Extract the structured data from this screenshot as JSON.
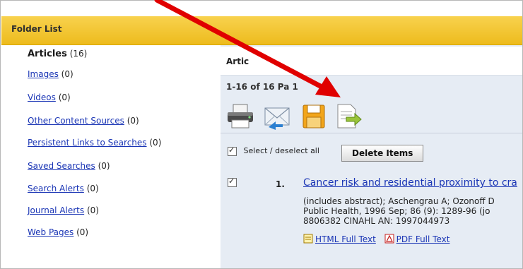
{
  "panel": {
    "title": "Folder List"
  },
  "sidebar": {
    "items": [
      {
        "label": "Articles",
        "count": "(16)"
      },
      {
        "label": "Images",
        "count": "(0)"
      },
      {
        "label": "Videos",
        "count": "(0)"
      },
      {
        "label": "Other Content Sources",
        "count": "(0)"
      },
      {
        "label": "Persistent Links to Searches",
        "count": "(0)"
      },
      {
        "label": "Saved Searches",
        "count": "(0)"
      },
      {
        "label": "Search Alerts",
        "count": "(0)"
      },
      {
        "label": "Journal Alerts",
        "count": "(0)"
      },
      {
        "label": "Web Pages",
        "count": "(0)"
      }
    ]
  },
  "main": {
    "column_title": "Artic",
    "paging": "1-16 of 16   Pa",
    "page_number": "1",
    "toolbar": {
      "icons": [
        "printer-icon",
        "email-icon",
        "save-disk-icon",
        "export-document-icon"
      ]
    },
    "select_all_label": "Select / deselect all",
    "delete_label": "Delete Items",
    "result": {
      "number": "1.",
      "title": "Cancer risk and residential proximity to cra",
      "meta_line1": "(includes abstract); Aschengrau A; Ozonoff D",
      "meta_line2": "Public Health, 1996 Sep; 86 (9): 1289-96 (jo",
      "meta_line3": "8806382 CINAHL AN: 1997044973",
      "html_link": "HTML Full Text",
      "pdf_link": "PDF Full Text"
    }
  },
  "colors": {
    "header_gold": "#f2c433",
    "link_blue": "#1a35b5",
    "arrow_red": "#e00000",
    "main_bg": "#e6ecf4"
  }
}
